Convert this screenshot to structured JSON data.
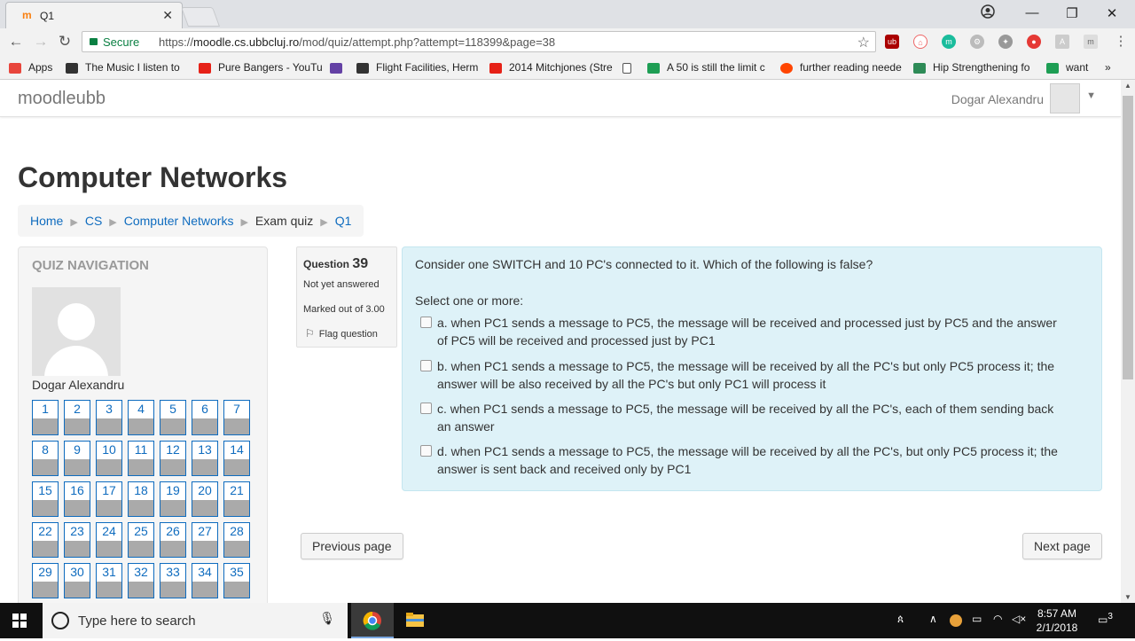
{
  "browser": {
    "tab_title": "Q1",
    "tab_favicon": "m",
    "secure_label": "Secure",
    "url_scheme": "https://",
    "url_host": "moodle.cs.ubbcluj.ro",
    "url_path": "/mod/quiz/attempt.php?attempt=118399&page=38",
    "bookmarks": [
      {
        "label": "Apps",
        "icon": "apps-grid-icon",
        "color": "#e8453c"
      },
      {
        "label": "The Music I listen to",
        "icon": "mask-icon",
        "color": "#333333"
      },
      {
        "label": "Pure Bangers - YouTu",
        "icon": "youtube-icon",
        "color": "#e62117"
      },
      {
        "label": "",
        "icon": "twitch-icon",
        "color": "#6441a5"
      },
      {
        "label": "Flight Facilities, Herm",
        "icon": "mask-icon",
        "color": "#333333"
      },
      {
        "label": "2014 Mitchjones (Stre",
        "icon": "youtube-icon",
        "color": "#e62117"
      },
      {
        "label": "",
        "icon": "page-icon",
        "color": "#ffffff"
      },
      {
        "label": "A 50 is still the limit c",
        "icon": "bookmark-green-icon",
        "color": "#1e9e54"
      },
      {
        "label": "further reading neede",
        "icon": "reddit-icon",
        "color": "#ff4500"
      },
      {
        "label": "Hip Strengthening fo",
        "icon": "runner-icon",
        "color": "#2e8b57"
      },
      {
        "label": "want",
        "icon": "bookmark-green-icon",
        "color": "#1e9e54"
      }
    ],
    "bookmarks_more": "»"
  },
  "moodle": {
    "brand": "moodleubb",
    "user_name": "Dogar Alexandru"
  },
  "page": {
    "course_title": "Computer Networks",
    "breadcrumb": [
      {
        "label": "Home",
        "link": true
      },
      {
        "label": "CS",
        "link": true
      },
      {
        "label": "Computer Networks",
        "link": true
      },
      {
        "label": "Exam quiz",
        "link": false
      },
      {
        "label": "Q1",
        "link": true
      }
    ]
  },
  "quiz_nav": {
    "title": "QUIZ NAVIGATION",
    "user_name": "Dogar Alexandru",
    "questions": [
      "1",
      "2",
      "3",
      "4",
      "5",
      "6",
      "7",
      "8",
      "9",
      "10",
      "11",
      "12",
      "13",
      "14",
      "15",
      "16",
      "17",
      "18",
      "19",
      "20",
      "21",
      "22",
      "23",
      "24",
      "25",
      "26",
      "27",
      "28",
      "29",
      "30",
      "31",
      "32",
      "33",
      "34",
      "35"
    ]
  },
  "question": {
    "label": "Question",
    "number": "39",
    "state": "Not yet answered",
    "mark": "Marked out of 3.00",
    "flag": "Flag question",
    "text": "Consider one SWITCH and 10 PC's connected to it. Which of the following is false?",
    "prompt": "Select one or more:",
    "answers": [
      {
        "line1": "a. when PC1 sends a message to PC5, the message will be received and processed just by PC5 and the answer",
        "line2": "of PC5 will be received and processed just by PC1"
      },
      {
        "line1": "b. when PC1 sends a message to PC5, the message will be received by all the PC's but only PC5 process it; the",
        "line2": "answer will be also received by all the PC's but only PC1 will process it"
      },
      {
        "line1": "c. when PC1 sends a message to PC5, the message will be received by all the PC's, each of them sending back",
        "line2": "an answer"
      },
      {
        "line1": "d. when PC1 sends a message to PC5, the message will be received by all the PC's, but only PC5 process it; the",
        "line2": "answer is sent back and received only by PC1"
      }
    ]
  },
  "buttons": {
    "previous": "Previous page",
    "next": "Next page"
  },
  "taskbar": {
    "search_placeholder": "Type here to search",
    "time": "8:57 AM",
    "date": "2/1/2018",
    "notifications": "3"
  },
  "colors": {
    "link": "#0f6cbf",
    "question_bg": "#def2f8",
    "accent_orange": "#f98012"
  }
}
